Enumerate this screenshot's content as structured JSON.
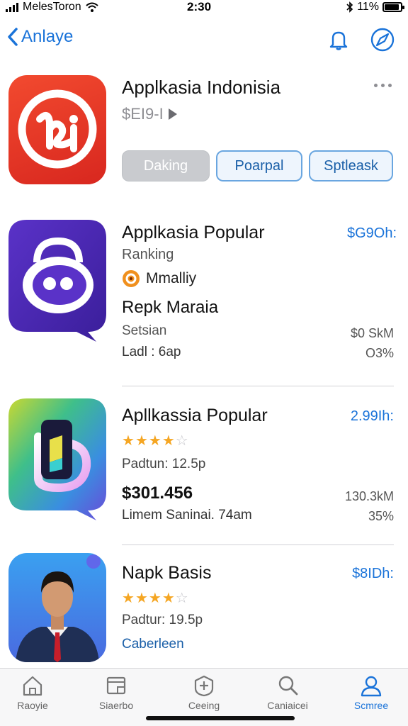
{
  "status_bar": {
    "carrier": "MelesToron",
    "time": "2:30",
    "battery": "11%",
    "icons": [
      "signal-icon",
      "wifi-icon",
      "bluetooth-icon",
      "battery-icon"
    ]
  },
  "nav": {
    "back_label": "Anlaye",
    "icons": [
      "bell-icon",
      "compass-icon"
    ]
  },
  "featured": {
    "title": "Applkasia Indonisia",
    "price": "$EI9-I",
    "buttons": [
      {
        "label": "Daking",
        "style": "grey"
      },
      {
        "label": "Poarpal",
        "style": "blue"
      },
      {
        "label": "Sptleask",
        "style": "blue"
      }
    ]
  },
  "apps": [
    {
      "title": "Applkasia Popular",
      "price": "$G9Oh:",
      "subtitle": "Ranking",
      "badge": "Mmalliy",
      "name": "Repk Maraia",
      "meta_left_1": "Setsian",
      "meta_right_1": "$0 SkM",
      "meta_left_2": "Ladl : 6ap",
      "meta_right_2": "O3%"
    },
    {
      "title": "Apllkassia Popular",
      "price": "2.99Ih:",
      "rating": 4.5,
      "downloads": "Padtun: 12.5p",
      "amount": "$301.456",
      "size": "130.3kM",
      "meta": "Limem Saninai. 74am",
      "percent": "35%"
    },
    {
      "title": "Napk Basis",
      "price": "$8IDh:",
      "rating": 4.5,
      "downloads": "Padtur: 19.5p",
      "category": "Caberleen"
    }
  ],
  "tabbar": {
    "tabs": [
      {
        "label": "Raoyie",
        "icon": "home-icon"
      },
      {
        "label": "Siaerbo",
        "icon": "window-icon"
      },
      {
        "label": "Ceeing",
        "icon": "plus-shield-icon"
      },
      {
        "label": "Caniaicei",
        "icon": "search-icon"
      },
      {
        "label": "Scmree",
        "icon": "person-icon"
      }
    ],
    "active": 4
  },
  "colors": {
    "accent": "#1a73d9",
    "star": "#f5a623",
    "red_app": "#e03a2a",
    "purple_app": "#4a2aa8"
  }
}
